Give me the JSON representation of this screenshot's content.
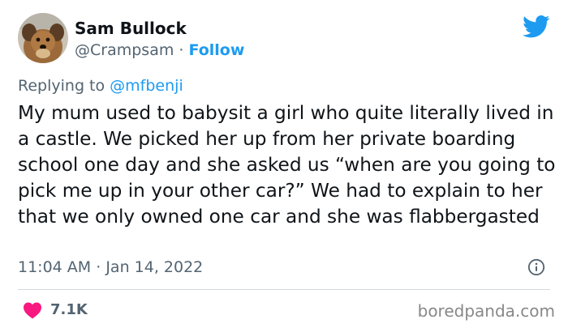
{
  "author": {
    "name": "Sam Bullock",
    "handle": "@Crampsam",
    "separator": "·",
    "follow_label": "Follow"
  },
  "reply": {
    "prefix": "Replying to",
    "target": "@mfbenji"
  },
  "tweet": {
    "text": "My mum used to babysit a girl who quite literally lived in a castle. We picked her up from her private boarding school one day and she asked us “when are you going to pick me up in your other car?” We had to explain to her that we only owned one car and she was flabbergasted",
    "time": "11:04 AM",
    "separator": "·",
    "date": "Jan 14, 2022"
  },
  "stats": {
    "likes": "7.1K"
  },
  "watermark": "boredpanda.com",
  "colors": {
    "accent": "#1d9bf0",
    "like": "#f91880",
    "muted": "#536471",
    "text": "#0f1419"
  },
  "icons": {
    "brand": "twitter-bird-icon",
    "info": "info-icon",
    "like": "heart-icon",
    "avatar": "dog-avatar"
  }
}
